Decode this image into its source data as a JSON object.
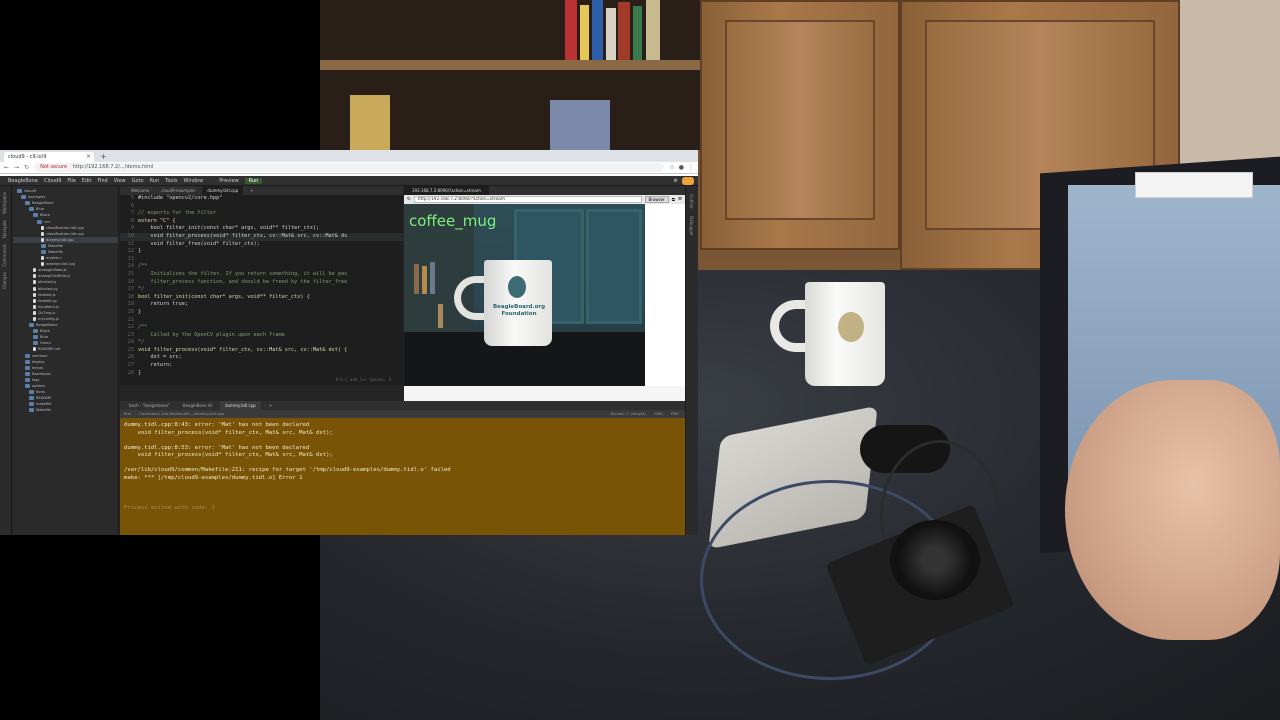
{
  "browser": {
    "tab_title": "cloud9 - c9.io/9",
    "url": "http://192.168.7.2/.../demo.html",
    "not_secure": "Not secure",
    "new_tab": "+"
  },
  "ide": {
    "menu": [
      "BeagleBone",
      "Cloud9",
      "File",
      "Edit",
      "Find",
      "View",
      "Goto",
      "Run",
      "Tools",
      "Window"
    ],
    "preview_label": "Preview",
    "run_label": "Run",
    "left_rail": [
      "Workspace",
      "Navigate",
      "Commands",
      "Changes"
    ],
    "right_rail": [
      "Outline",
      "Debugger"
    ],
    "file_tree": [
      "cloud9",
      "examples",
      "BeagleBone",
      "Blue",
      "Black",
      "cnn",
      "classification.tidl.cpp",
      "classification.tidl.cpp",
      "dummy.tidl.cpp",
      "Makefile",
      "Makefile",
      "mytest.c",
      "weather.tidl.cpp",
      "analogInRead.js",
      "analogOutWrite.js",
      "blinkled.js",
      "blinkled.py",
      "fadeled.js",
      "fadeled.py",
      "handleInt.js",
      "i2cTmp.js",
      "myconfig.js",
      "BeagleBone",
      "Black",
      "Blue",
      "Green",
      "README.md",
      "common",
      "display",
      "extras",
      "fixedrepos",
      "logs",
      "options",
      "fonts",
      "README",
      "makefile",
      "Makefile"
    ],
    "editor_tabs": [
      "Welcome",
      "cloud9-examples",
      "dummy.tidl.cpp",
      "+"
    ],
    "code_lines": [
      {
        "n": "5",
        "t": "#include \"opencv2/core.hpp\""
      },
      {
        "n": "6",
        "t": ""
      },
      {
        "n": "7",
        "t": "// exports for the filter"
      },
      {
        "n": "8",
        "t": "extern \"C\" {"
      },
      {
        "n": "9",
        "t": "    bool filter_init(const char* args, void** filter_ctx);"
      },
      {
        "n": "10",
        "t": "    void filter_process(void* filter_ctx, cv::Mat& src, cv::Mat& ds"
      },
      {
        "n": "11",
        "t": "    void filter_free(void* filter_ctx);"
      },
      {
        "n": "12",
        "t": "}"
      },
      {
        "n": "13",
        "t": ""
      },
      {
        "n": "14",
        "t": "/**"
      },
      {
        "n": "15",
        "t": "    Initializes the filter. If you return something, it will be pas"
      },
      {
        "n": "16",
        "t": "    filter_process function, and should be freed by the filter_free"
      },
      {
        "n": "17",
        "t": "*/"
      },
      {
        "n": "18",
        "t": "bool filter_init(const char* args, void** filter_ctx) {"
      },
      {
        "n": "19",
        "t": "    return true;"
      },
      {
        "n": "20",
        "t": "}"
      },
      {
        "n": "21",
        "t": ""
      },
      {
        "n": "22",
        "t": "/**"
      },
      {
        "n": "23",
        "t": "    Called by the OpenCV plugin upon each frame"
      },
      {
        "n": "24",
        "t": "*/"
      },
      {
        "n": "25",
        "t": "void filter_process(void* filter_ctx, cv::Mat& src, cv::Mat& dst) {"
      },
      {
        "n": "26",
        "t": "    dst = src;"
      },
      {
        "n": "27",
        "t": "    return;"
      },
      {
        "n": "28",
        "t": "}"
      }
    ],
    "editor_status": "8:6   C and C++   Spaces: 4",
    "preview": {
      "tab": "192.168.7.2:8090/?action=stream",
      "url": "http://192.168.7.2:8090/?action=stream",
      "browser_button": "Browser",
      "label": "coffee_mug",
      "mug_text": "BeagleBoard.org Foundation"
    },
    "terminal_tabs": [
      "bash - \"beaglebone\"",
      "BeagleBone AI",
      "dummy.tidl.cpp",
      "+"
    ],
    "terminal_sub": [
      "Run",
      "Command: /var/lib/cloud9/.../dummy.tidl.cpp",
      "Runner: C (simple)",
      "CWD",
      "ENV"
    ],
    "terminal_lines": [
      {
        "t": "dummy.tidl.cpp:8:43: error: 'Mat' has not been declared",
        "dim": false
      },
      {
        "t": "    void filter_process(void* filter_ctx, Mat& src, Mat& dst);",
        "dim": false
      },
      {
        "t": "",
        "dim": false
      },
      {
        "t": "dummy.tidl.cpp:8:53: error: 'Mat' has not been declared",
        "dim": false
      },
      {
        "t": "    void filter_process(void* filter_ctx, Mat& src, Mat& dst);",
        "dim": false
      },
      {
        "t": "",
        "dim": false
      },
      {
        "t": "/var/lib/cloud9/common/Makefile:211: recipe for target '/tmp/cloud9-examples/dummy.tidl.o' failed",
        "dim": false
      },
      {
        "t": "make: *** [/tmp/cloud9-examples/dummy.tidl.o] Error 1",
        "dim": false
      },
      {
        "t": "",
        "dim": false
      },
      {
        "t": "",
        "dim": false
      },
      {
        "t": "",
        "dim": false
      },
      {
        "t": "Process exited with code: 2",
        "dim": true
      }
    ]
  },
  "colors": {
    "terminal_bg": "#7a5406",
    "label_green": "#7ef07e",
    "editor_bg": "#1e1e1e"
  }
}
